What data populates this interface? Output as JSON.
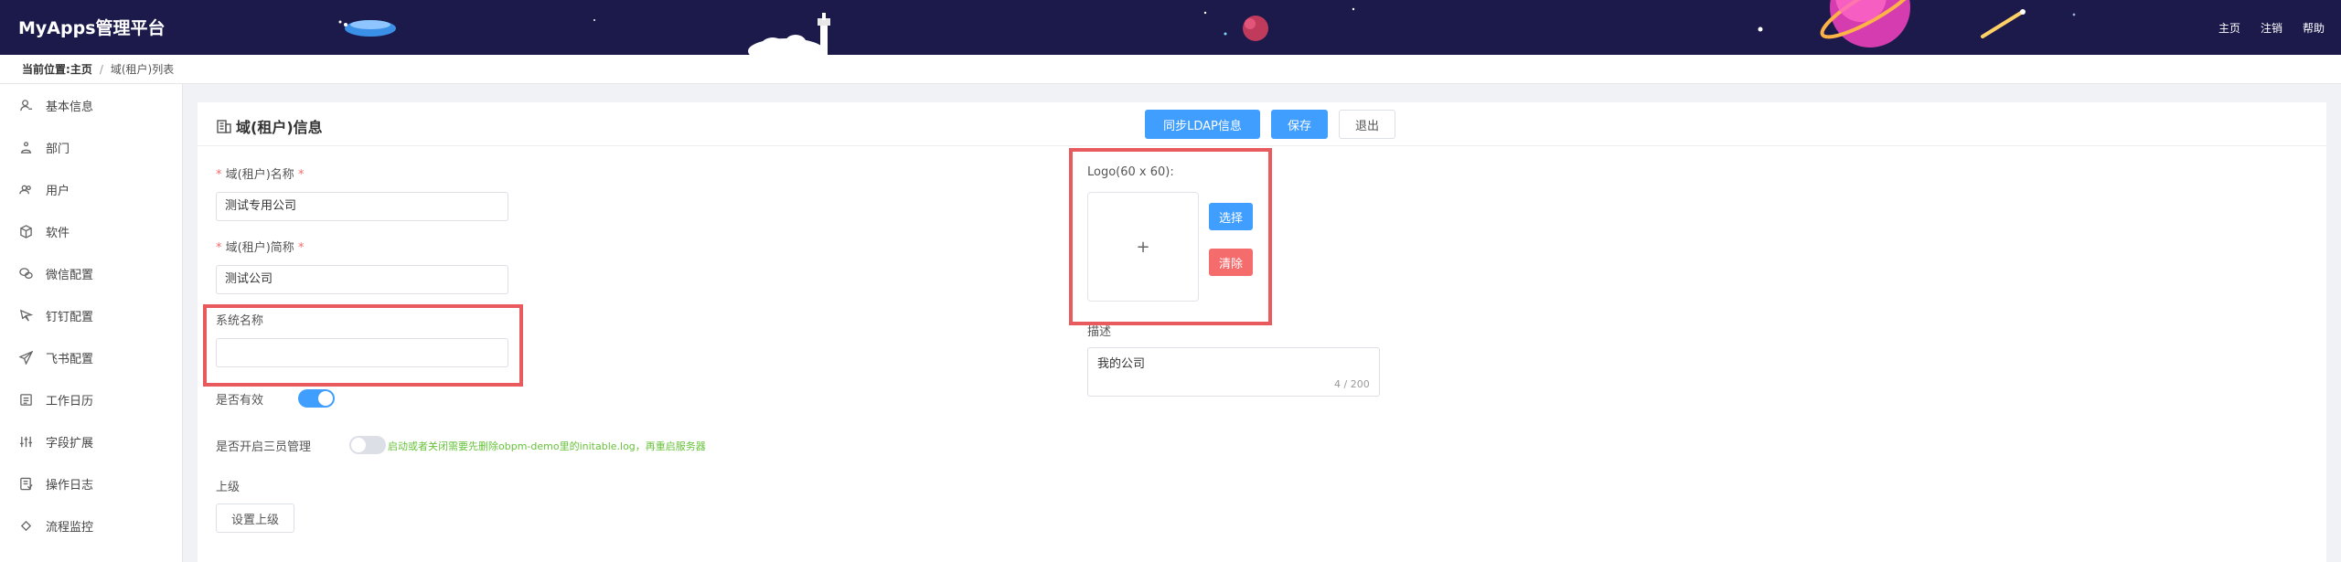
{
  "app": {
    "title": "MyApps管理平台"
  },
  "topnav": [
    "主页",
    "注销",
    "帮助"
  ],
  "breadcrumb": {
    "prefix": "当前位置:",
    "home": "主页",
    "separator": "/",
    "current": "域(租户)列表"
  },
  "sidebar": {
    "items": [
      {
        "label": "基本信息",
        "icon": "user-info-icon"
      },
      {
        "label": "部门",
        "icon": "org-chart-icon"
      },
      {
        "label": "用户",
        "icon": "users-icon"
      },
      {
        "label": "软件",
        "icon": "cube-icon"
      },
      {
        "label": "微信配置",
        "icon": "wechat-icon"
      },
      {
        "label": "钉钉配置",
        "icon": "dingtalk-icon"
      },
      {
        "label": "飞书配置",
        "icon": "paper-plane-icon"
      },
      {
        "label": "工作日历",
        "icon": "calendar-icon"
      },
      {
        "label": "字段扩展",
        "icon": "sliders-icon"
      },
      {
        "label": "操作日志",
        "icon": "log-icon"
      },
      {
        "label": "流程监控",
        "icon": "diamond-icon"
      }
    ]
  },
  "panel": {
    "title": "域(租户)信息",
    "sync_ldap_label": "同步LDAP信息",
    "save_label": "保存",
    "exit_label": "退出"
  },
  "form": {
    "domain_name": {
      "label": "域(租户)名称",
      "required_mark": "*",
      "value": "测试专用公司"
    },
    "domain_short": {
      "label": "域(租户)简称",
      "required_mark": "*",
      "value": "测试公司"
    },
    "system_name": {
      "label": "系统名称",
      "value": ""
    },
    "is_active": {
      "label": "是否有效",
      "on": true
    },
    "three_admin": {
      "label": "是否开启三员管理",
      "on": false,
      "hint": "启动或者关闭需要先删除obpm-demo里的initable.log，再重启服务器"
    },
    "parent": {
      "label": "上级",
      "button_label": "设置上级"
    },
    "logo": {
      "label": "Logo(60 x 60):",
      "placeholder": "+",
      "choose_label": "选择",
      "clear_label": "清除"
    },
    "description": {
      "label": "描述",
      "value": "我的公司",
      "counter": "4 / 200"
    }
  },
  "colors": {
    "header_bg": "#1b1a4a",
    "primary": "#409eff",
    "danger": "#f56c6c",
    "annotation": "#e85a5e",
    "hint": "#67c23a"
  }
}
